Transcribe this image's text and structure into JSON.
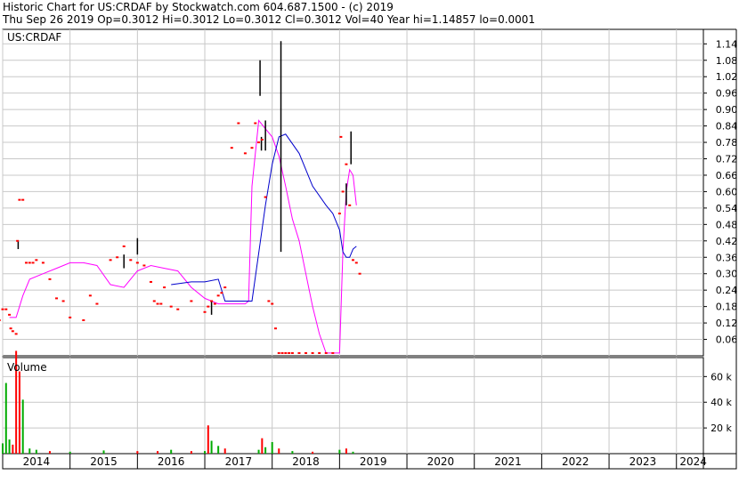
{
  "header": {
    "title_line": "Historic Chart for US:CRDAF by Stockwatch.com 604.687.1500 - (c) 2019",
    "quote_line": "Thu Sep 26 2019  Op=0.3012  Hi=0.3012  Lo=0.3012  Cl=0.3012  Vol=40  Year hi=1.14857  lo=0.0001"
  },
  "chart_data": [
    {
      "type": "line",
      "panel": "price",
      "symbol_label": "US:CRDAF",
      "y_ticks": [
        "1.14",
        "1.08",
        "1.02",
        "0.96",
        "0.90",
        "0.84",
        "0.78",
        "0.72",
        "0.66",
        "0.60",
        "0.54",
        "0.48",
        "0.42",
        "0.36",
        "0.30",
        "0.24",
        "0.18",
        "0.12",
        "0.06"
      ],
      "ylim": [
        0,
        1.18
      ],
      "xlim": [
        2014.0,
        2024.4
      ],
      "x_ticks": [
        "2014",
        "2015",
        "2016",
        "2017",
        "2018",
        "2019",
        "2020",
        "2021",
        "2022",
        "2023",
        "2024"
      ],
      "colors": {
        "price": "#ff0000",
        "ma_short": "#ff00ff",
        "ma_long": "#0000cc",
        "bars": "#000000",
        "grid": "#c8c8c8"
      },
      "series": [
        {
          "key": "price",
          "x": [
            2013.85,
            2013.9,
            2013.95,
            2014.0,
            2014.05,
            2014.1,
            2014.12,
            2014.15,
            2014.2,
            2014.22,
            2014.25,
            2014.3,
            2014.35,
            2014.4,
            2014.45,
            2014.5,
            2014.6,
            2014.7,
            2014.8,
            2014.9,
            2015.0,
            2015.2,
            2015.3,
            2015.4,
            2015.6,
            2015.7,
            2015.8,
            2015.9,
            2016.0,
            2016.1,
            2016.2,
            2016.25,
            2016.3,
            2016.35,
            2016.4,
            2016.5,
            2016.6,
            2016.8,
            2017.0,
            2017.05,
            2017.1,
            2017.15,
            2017.2,
            2017.25,
            2017.3,
            2017.4,
            2017.5,
            2017.6,
            2017.7,
            2017.75,
            2017.8,
            2017.85,
            2017.9,
            2017.95,
            2018.0,
            2018.05,
            2018.1,
            2018.15,
            2018.2,
            2018.25,
            2018.3,
            2018.4,
            2018.5,
            2018.6,
            2018.7,
            2018.8,
            2018.9,
            2019.0,
            2019.02,
            2019.05,
            2019.1,
            2019.15,
            2019.2,
            2019.25,
            2019.3
          ],
          "values": [
            0.14,
            0.14,
            0.13,
            0.17,
            0.17,
            0.15,
            0.1,
            0.09,
            0.08,
            0.42,
            0.57,
            0.57,
            0.34,
            0.34,
            0.34,
            0.35,
            0.34,
            0.28,
            0.21,
            0.2,
            0.14,
            0.13,
            0.22,
            0.19,
            0.35,
            0.36,
            0.4,
            0.35,
            0.34,
            0.33,
            0.27,
            0.2,
            0.19,
            0.19,
            0.25,
            0.18,
            0.17,
            0.2,
            0.16,
            0.18,
            0.2,
            0.19,
            0.22,
            0.23,
            0.25,
            0.76,
            0.85,
            0.74,
            0.76,
            0.85,
            0.78,
            0.79,
            0.58,
            0.2,
            0.19,
            0.1,
            0.01,
            0.01,
            0.01,
            0.01,
            0.01,
            0.01,
            0.01,
            0.01,
            0.01,
            0.01,
            0.01,
            0.52,
            0.8,
            0.6,
            0.7,
            0.55,
            0.35,
            0.34,
            0.3
          ]
        },
        {
          "key": "ma_short",
          "x": [
            2014.1,
            2014.2,
            2014.3,
            2014.4,
            2014.6,
            2014.8,
            2015.0,
            2015.2,
            2015.4,
            2015.6,
            2015.8,
            2016.0,
            2016.2,
            2016.4,
            2016.6,
            2016.8,
            2017.0,
            2017.2,
            2017.4,
            2017.6,
            2017.65,
            2017.7,
            2017.8,
            2017.9,
            2018.0,
            2018.1,
            2018.2,
            2018.3,
            2018.4,
            2018.5,
            2018.6,
            2018.7,
            2018.8,
            2018.9,
            2019.0,
            2019.05,
            2019.1,
            2019.15,
            2019.2,
            2019.25
          ],
          "values": [
            0.14,
            0.14,
            0.22,
            0.28,
            0.3,
            0.32,
            0.34,
            0.34,
            0.33,
            0.26,
            0.25,
            0.31,
            0.33,
            0.32,
            0.31,
            0.25,
            0.21,
            0.19,
            0.19,
            0.19,
            0.2,
            0.62,
            0.86,
            0.83,
            0.8,
            0.73,
            0.62,
            0.5,
            0.42,
            0.3,
            0.18,
            0.08,
            0.01,
            0.01,
            0.01,
            0.38,
            0.6,
            0.68,
            0.66,
            0.55
          ]
        },
        {
          "key": "ma_long",
          "x": [
            2016.5,
            2016.8,
            2017.0,
            2017.2,
            2017.3,
            2017.5,
            2017.7,
            2017.9,
            2018.0,
            2018.1,
            2018.2,
            2018.4,
            2018.6,
            2018.8,
            2018.9,
            2019.0,
            2019.05,
            2019.1,
            2019.15,
            2019.2,
            2019.25
          ],
          "values": [
            0.26,
            0.27,
            0.27,
            0.28,
            0.2,
            0.2,
            0.2,
            0.55,
            0.7,
            0.8,
            0.81,
            0.74,
            0.62,
            0.55,
            0.52,
            0.46,
            0.38,
            0.36,
            0.36,
            0.39,
            0.4
          ]
        }
      ],
      "hl_bars": [
        {
          "x": 2014.23,
          "low": 0.39,
          "high": 0.42
        },
        {
          "x": 2015.8,
          "low": 0.32,
          "high": 0.37
        },
        {
          "x": 2016.0,
          "low": 0.37,
          "high": 0.43
        },
        {
          "x": 2017.1,
          "low": 0.15,
          "high": 0.2
        },
        {
          "x": 2017.82,
          "low": 0.95,
          "high": 1.08
        },
        {
          "x": 2017.84,
          "low": 0.75,
          "high": 0.8
        },
        {
          "x": 2017.9,
          "low": 0.75,
          "high": 0.86
        },
        {
          "x": 2018.13,
          "low": 0.38,
          "high": 1.15
        },
        {
          "x": 2019.1,
          "low": 0.55,
          "high": 0.63
        },
        {
          "x": 2019.17,
          "low": 0.7,
          "high": 0.82
        }
      ]
    },
    {
      "type": "bar",
      "panel": "volume",
      "label": "Volume",
      "y_ticks": [
        "60 k",
        "40 k",
        "20 k"
      ],
      "ylim": [
        0,
        72000
      ],
      "colors": {
        "up": "#00aa00",
        "down": "#ff0000"
      },
      "x": [
        2013.9,
        2014.0,
        2014.05,
        2014.1,
        2014.15,
        2014.2,
        2014.25,
        2014.3,
        2014.4,
        2014.5,
        2014.7,
        2015.0,
        2015.5,
        2016.0,
        2016.3,
        2016.5,
        2016.8,
        2017.0,
        2017.05,
        2017.1,
        2017.2,
        2017.3,
        2017.8,
        2017.85,
        2017.9,
        2018.0,
        2018.1,
        2018.3,
        2018.6,
        2019.0,
        2019.1,
        2019.2
      ],
      "values": [
        6000,
        8000,
        55000,
        11000,
        7000,
        80000,
        64000,
        42000,
        4000,
        3000,
        2000,
        1500,
        2500,
        2000,
        2000,
        3000,
        2000,
        2000,
        22000,
        10000,
        6000,
        4000,
        3000,
        12000,
        5000,
        9000,
        4000,
        2000,
        1500,
        3000,
        4000,
        1500
      ],
      "up": [
        true,
        true,
        true,
        true,
        false,
        false,
        false,
        true,
        true,
        true,
        false,
        true,
        true,
        false,
        false,
        true,
        false,
        true,
        false,
        true,
        true,
        false,
        true,
        false,
        true,
        true,
        false,
        true,
        false,
        true,
        false,
        true
      ]
    }
  ]
}
